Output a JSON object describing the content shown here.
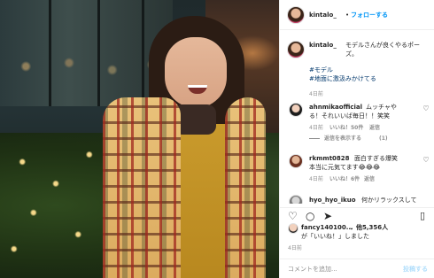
{
  "post": {
    "username": "kintalo_",
    "follow_label": "フォローする",
    "dot": "•",
    "caption_text": "モデルさんが良くやるポーズ。",
    "hashtags": [
      "#モデル",
      "#地面に激汲みかけてる"
    ],
    "posted_ago": "4日前"
  },
  "comments": [
    {
      "username": "ahnmikaofficial",
      "text_line1": "ムッチャや",
      "text_line2": "る！それいいば毎日！！笑笑",
      "meta": [
        "4日前",
        "いいね！50件",
        "返信"
      ],
      "replies_label": "返信を表示する",
      "reply_count": "(1)"
    },
    {
      "username": "rkmmt0828",
      "text_line1": "面白すぎる爆笑",
      "text_line2": "本当に元気てます😂😂😂",
      "meta": [
        "4日前",
        "いいね！6件",
        "返信"
      ]
    },
    {
      "username": "hyo_hyo_ikuo",
      "text_line1": "何かリラックスして",
      "text_line2": ""
    }
  ],
  "likes": {
    "liker": "fancy140100...",
    "others": "他5,356人",
    "suffix_text": "が「いいね！」しました",
    "date": "4日前"
  },
  "composer": {
    "placeholder": "コメントを追加...",
    "post_label": "投稿する"
  },
  "icons": {
    "like": "heart-icon",
    "comment": "comment-icon",
    "share": "share-icon",
    "save": "bookmark-icon"
  },
  "colors": {
    "accent": "#0095f6",
    "link": "#00376b",
    "muted": "#8e8e8e"
  }
}
